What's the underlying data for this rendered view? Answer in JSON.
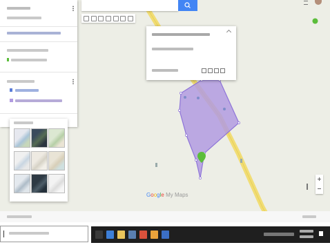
{
  "map": {
    "attribution": "",
    "logo": "Google My Maps",
    "place_labels": [
      "",
      "",
      "",
      ""
    ]
  },
  "search": {
    "value": "",
    "button_icon": "search-icon"
  },
  "toolbar": {
    "tools": [
      "undo-icon",
      "redo-icon",
      "hand-icon",
      "marker-icon",
      "line-icon",
      "directions-icon",
      "ruler-icon"
    ]
  },
  "left_panel": {
    "title": "",
    "subtitle": "",
    "actions": "",
    "layers": [
      {
        "title": "",
        "items": [
          "",
          ""
        ]
      },
      {
        "title": "",
        "items": [
          "",
          ""
        ]
      }
    ],
    "basemap_label": ""
  },
  "info_card": {
    "title": "",
    "description": "",
    "footer": ""
  },
  "bottom_bar": {
    "left_text": "",
    "right_text": ""
  },
  "taskbar": {
    "search_placeholder": "",
    "clock": "",
    "date": ""
  },
  "colors": {
    "polygon_fill": "#b19be0",
    "polygon_stroke": "#8e74d8",
    "road": "#f1dd75",
    "search_button": "#4285f4",
    "marker_green": "#5bbd3a",
    "taskbar": "#1f1f1f"
  }
}
